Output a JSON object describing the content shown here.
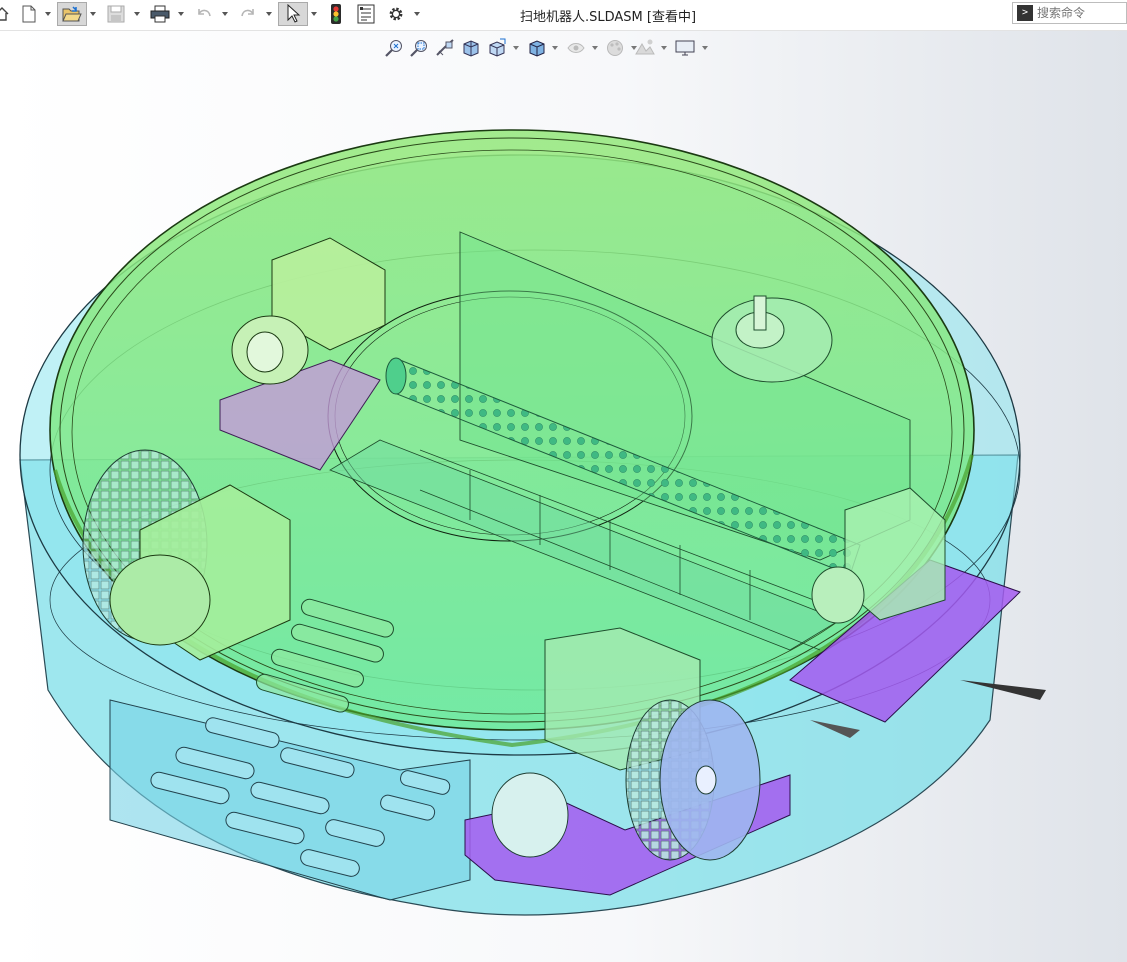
{
  "window": {
    "title": "扫地机器人.SLDASM [查看中]"
  },
  "search": {
    "placeholder": "搜索命令"
  },
  "toolbar": {
    "items": [
      "home-icon",
      "new-document-icon",
      "open-file-icon",
      "save-icon",
      "print-icon",
      "undo-icon",
      "redo-icon",
      "select-pointer-icon",
      "rebuild-icon",
      "file-properties-icon",
      "options-gear-icon"
    ],
    "selected": "select-pointer-icon"
  },
  "view_toolbar": {
    "items": [
      "zoom-to-fit-icon",
      "zoom-to-area-icon",
      "previous-view-icon",
      "section-view-icon",
      "view-orientation-icon",
      "display-style-icon",
      "hide-show-items-icon",
      "edit-appearance-icon",
      "apply-scene-icon",
      "view-settings-icon"
    ]
  },
  "model": {
    "name": "扫地机器人",
    "colors": {
      "housing": "#6fe0ee",
      "lid": "#8ee87a",
      "brush": "#4fcf8c",
      "mount": "#a45af0",
      "bracket": "#c39ad8"
    }
  }
}
